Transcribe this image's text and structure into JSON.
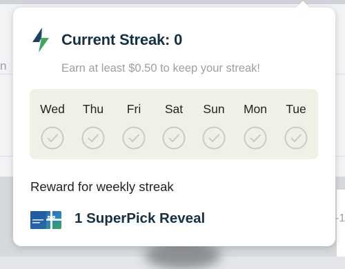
{
  "background": {
    "left_partial_text": "n",
    "right_partial_text": "-1"
  },
  "streak": {
    "title": "Current Streak: 0",
    "subtitle": "Earn at least $0.50 to keep your streak!",
    "icon": "lightning-bolt-icon",
    "icon_colors": [
      "#1d3f66",
      "#3aa856"
    ]
  },
  "days": [
    {
      "label": "Wed",
      "completed": false
    },
    {
      "label": "Thu",
      "completed": false
    },
    {
      "label": "Fri",
      "completed": false
    },
    {
      "label": "Sat",
      "completed": false
    },
    {
      "label": "Sun",
      "completed": false
    },
    {
      "label": "Mon",
      "completed": false
    },
    {
      "label": "Tue",
      "completed": false
    }
  ],
  "reward": {
    "label": "Reward for weekly streak",
    "item": "1 SuperPick Reveal",
    "icon": "gift-card-icon"
  },
  "colors": {
    "title_text": "#143047",
    "days_background": "#eef2e6",
    "check_inactive": "#c9cac6"
  }
}
